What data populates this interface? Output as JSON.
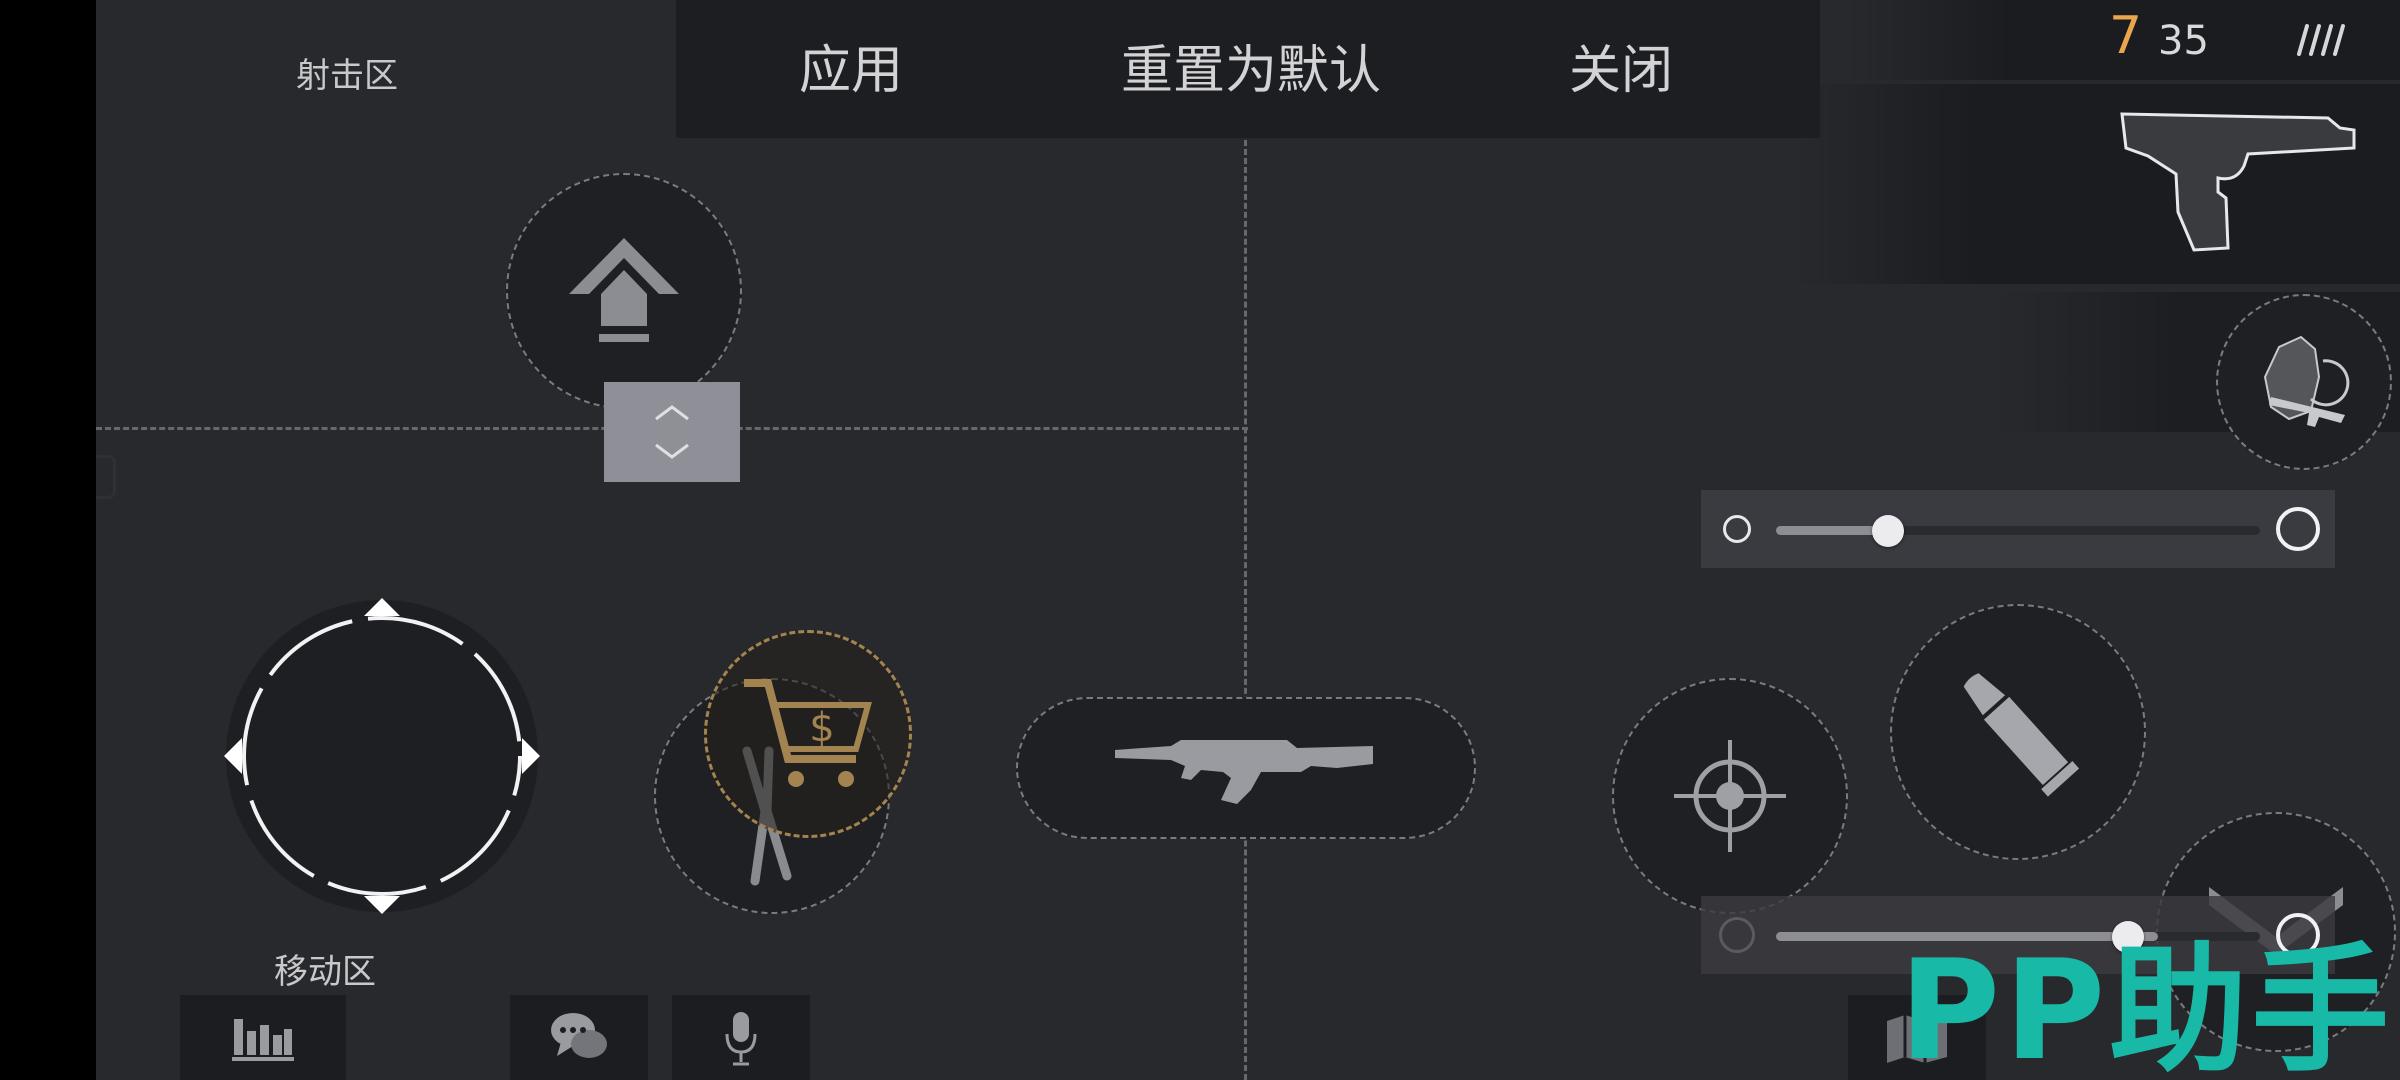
{
  "zones": {
    "shoot_label": "射击区",
    "move_label": "移动区"
  },
  "topbar": {
    "apply_label": "应用",
    "reset_label": "重置为默认",
    "close_label": "关闭"
  },
  "ammo": {
    "current": "7",
    "reserve": "35"
  },
  "sliders": [
    {
      "name": "size-slider",
      "value": 0.23
    },
    {
      "name": "opacity-slider",
      "value": 0.79
    }
  ],
  "watermark": {
    "text": "PP助手"
  },
  "colors": {
    "background": "#28292d",
    "panel": "#1d1e21",
    "ammo_accent": "#e9a64c",
    "shop_ring": "#a38350",
    "watermark": "#19b9a8"
  },
  "icons": [
    "jump-icon",
    "resize-handle-icon",
    "joystick-icon",
    "shop-cart-icon",
    "defuse-pliers-icon",
    "rifle-ak-icon",
    "aim-crosshair-icon",
    "reload-bullet-icon",
    "crouch-icon",
    "pistol-icon",
    "grenade-swap-icon",
    "stats-icon",
    "chat-icon",
    "mic-icon",
    "map-icon"
  ]
}
